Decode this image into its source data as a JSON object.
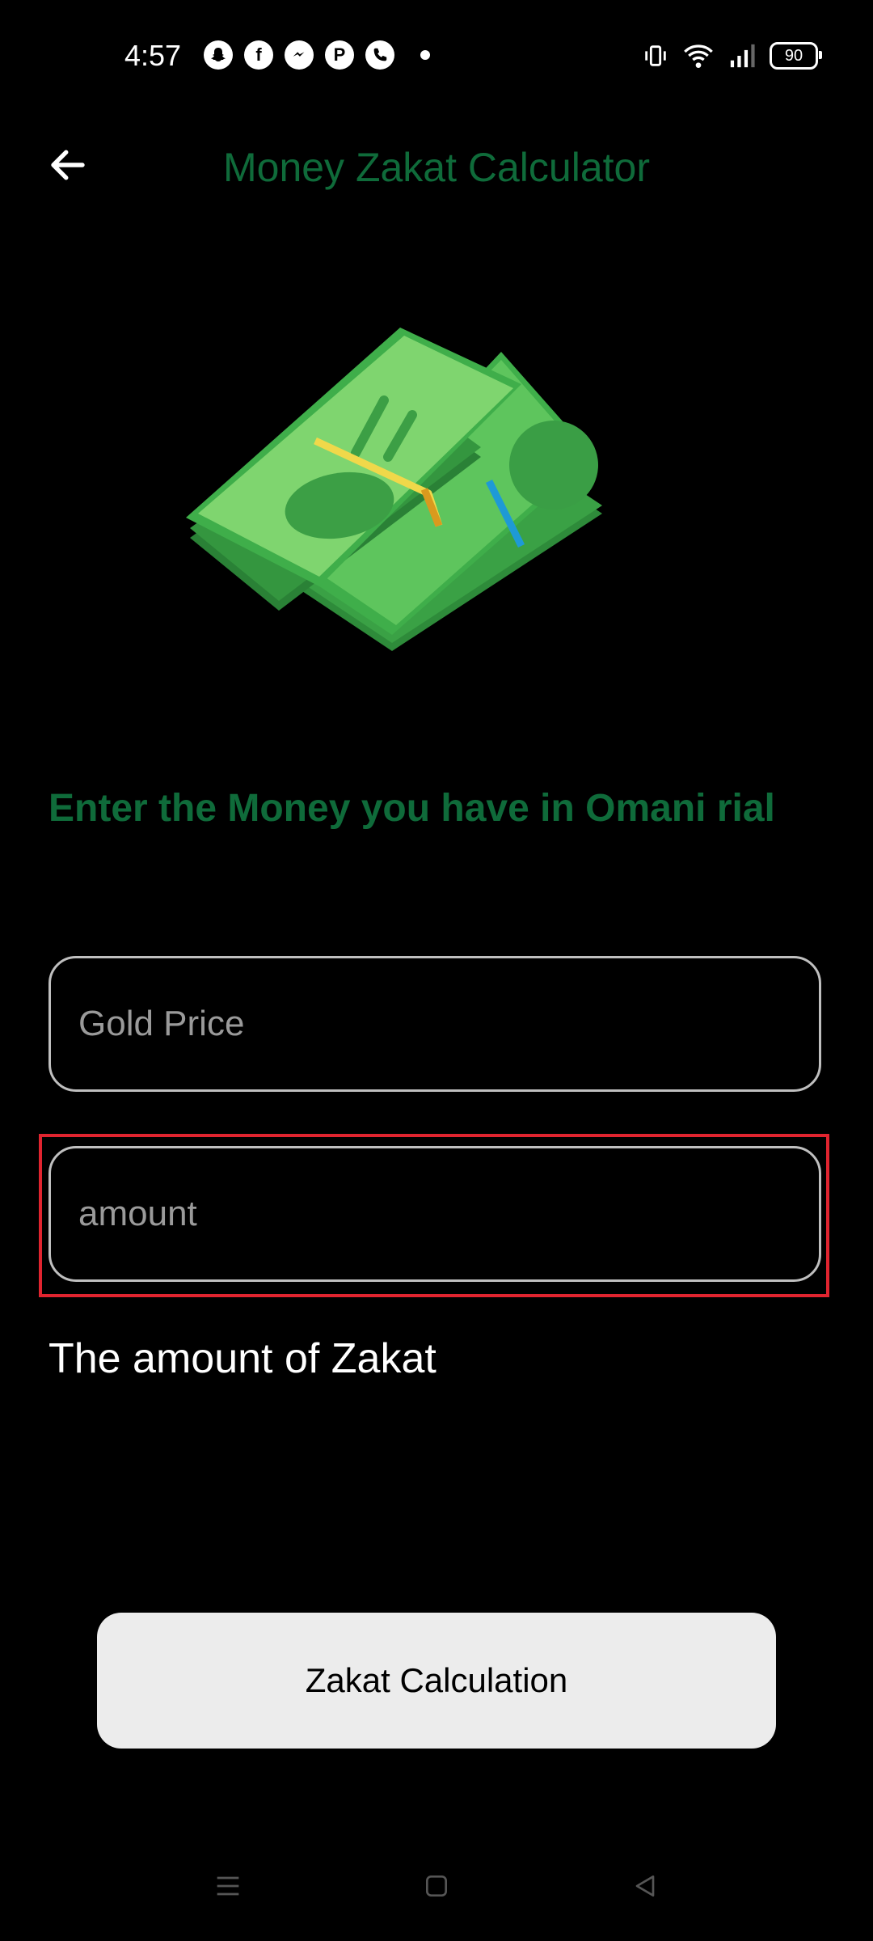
{
  "status_bar": {
    "time": "4:57",
    "battery": "90",
    "notification_icons": [
      "snapchat-icon",
      "facebook-icon",
      "messenger-icon",
      "pinterest-icon",
      "phone-icon"
    ]
  },
  "app_bar": {
    "title": "Money Zakat Calculator",
    "back_icon": "arrow-back-icon"
  },
  "prompt": "Enter the Money you have in Omani rial",
  "inputs": {
    "gold_price": {
      "value": "",
      "placeholder": "Gold Price"
    },
    "amount": {
      "value": "",
      "placeholder": "amount"
    }
  },
  "result_label": "The amount of Zakat",
  "button": {
    "label": "Zakat Calculation"
  },
  "colors": {
    "background": "#000000",
    "accent_green": "#0f6b3a",
    "button_bg": "#ececec",
    "highlight": "#e0242f"
  }
}
